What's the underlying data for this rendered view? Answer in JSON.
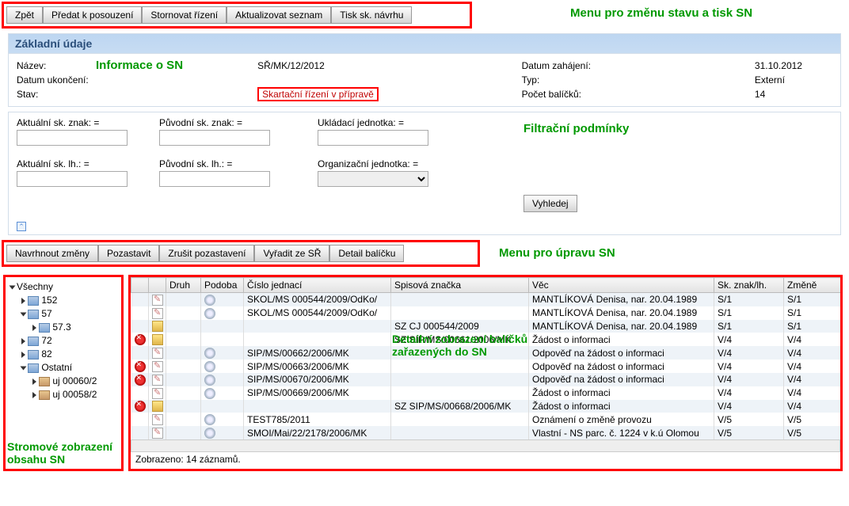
{
  "annot": {
    "menu1": "Menu pro změnu stavu a tisk SN",
    "info": "Informace o SN",
    "filters": "Filtrační podmínky",
    "menu2": "Menu pro úpravu SN",
    "tree": "Stromové zobrazení obsahu SN",
    "detail": "Detailní zobrazení balíčků zařazených do SN"
  },
  "toolbar1": {
    "btn1": "Zpět",
    "btn2": "Předat k posouzení",
    "btn3": "Stornovat řízení",
    "btn4": "Aktualizovat seznam",
    "btn5": "Tisk sk. návrhu"
  },
  "panel": {
    "title": "Základní údaje"
  },
  "info": {
    "left": {
      "nazev_lbl": "Název:",
      "datum_uk_lbl": "Datum ukončení:",
      "stav_lbl": "Stav:"
    },
    "mid": {
      "nazev_val": "SŘ/MK/12/2012",
      "stav_val": "Skartační řízení v přípravě"
    },
    "right": {
      "datum_zah_lbl": "Datum zahájení:",
      "typ_lbl": "Typ:",
      "pocet_lbl": "Počet balíčků:"
    },
    "vals": {
      "datum_zah": "31.10.2012",
      "typ": "Externí",
      "pocet": "14"
    }
  },
  "filters": {
    "f1": "Aktuální sk. znak: =",
    "f2": "Původní sk. znak: =",
    "f3": "Ukládací jednotka: =",
    "f4": "Aktuální sk. lh.: =",
    "f5": "Původní sk. lh.: =",
    "f6": "Organizační jednotka: =",
    "search": "Vyhledej"
  },
  "toolbar2": {
    "btn1": "Navrhnout změny",
    "btn2": "Pozastavit",
    "btn3": "Zrušit pozastavení",
    "btn4": "Vyřadit ze SŘ",
    "btn5": "Detail balíčku"
  },
  "tree": {
    "root": "Všechny",
    "n1": "152",
    "n2": "57",
    "n2_1": "57.3",
    "n3": "72",
    "n4": "82",
    "n5": "Ostatní",
    "n5_1": "uj 00060/2",
    "n5_2": "uj 00058/2"
  },
  "table": {
    "headers": {
      "c1": "",
      "c2": "Druh",
      "c3": "Podoba",
      "c4": "Číslo jednací",
      "c5": "Spisová značka",
      "c6": "Věc",
      "c7": "Sk. znak/lh.",
      "c8": "Změně"
    },
    "rows": [
      {
        "del": false,
        "folder": false,
        "cj": "SKOL/MS 000544/2009/OdKo/",
        "sz": "",
        "vec": "MANTLÍKOVÁ Denisa, nar. 20.04.1989",
        "sk": "S/1",
        "zm": "S/1"
      },
      {
        "del": false,
        "folder": false,
        "cj": "SKOL/MS 000544/2009/OdKo/",
        "sz": "",
        "vec": "MANTLÍKOVÁ Denisa, nar. 20.04.1989",
        "sk": "S/1",
        "zm": "S/1"
      },
      {
        "del": false,
        "folder": true,
        "cj": "",
        "sz": "SZ CJ 000544/2009",
        "vec": "MANTLÍKOVÁ Denisa, nar. 20.04.1989",
        "sk": "S/1",
        "zm": "S/1"
      },
      {
        "del": true,
        "folder": true,
        "cj": "",
        "sz": "SZ SIP/MS/00661/2006/MK",
        "vec": "Žádost o informaci",
        "sk": "V/4",
        "zm": "V/4"
      },
      {
        "del": false,
        "folder": false,
        "cj": "SIP/MS/00662/2006/MK",
        "sz": "",
        "vec": "Odpověď na žádost o informaci",
        "sk": "V/4",
        "zm": "V/4"
      },
      {
        "del": true,
        "folder": false,
        "cj": "SIP/MS/00663/2006/MK",
        "sz": "",
        "vec": "Odpověď na žádost o informaci",
        "sk": "V/4",
        "zm": "V/4"
      },
      {
        "del": true,
        "folder": false,
        "cj": "SIP/MS/00670/2006/MK",
        "sz": "",
        "vec": "Odpověď na žádost o informaci",
        "sk": "V/4",
        "zm": "V/4"
      },
      {
        "del": false,
        "folder": false,
        "cj": "SIP/MS/00669/2006/MK",
        "sz": "",
        "vec": "Žádost o informaci",
        "sk": "V/4",
        "zm": "V/4"
      },
      {
        "del": true,
        "folder": true,
        "cj": "",
        "sz": "SZ SIP/MS/00668/2006/MK",
        "vec": "Žádost o informaci",
        "sk": "V/4",
        "zm": "V/4"
      },
      {
        "del": false,
        "folder": false,
        "cj": "TEST785/2011",
        "sz": "",
        "vec": "Oznámení o změně provozu",
        "sk": "V/5",
        "zm": "V/5"
      },
      {
        "del": false,
        "folder": false,
        "cj": "SMOI/Mai/22/2178/2006/MK",
        "sz": "",
        "vec": "Vlastní - NS parc. č. 1224 v k.ú Olomou",
        "sk": "V/5",
        "zm": "V/5"
      }
    ],
    "status": "Zobrazeno: 14 záznamů."
  }
}
